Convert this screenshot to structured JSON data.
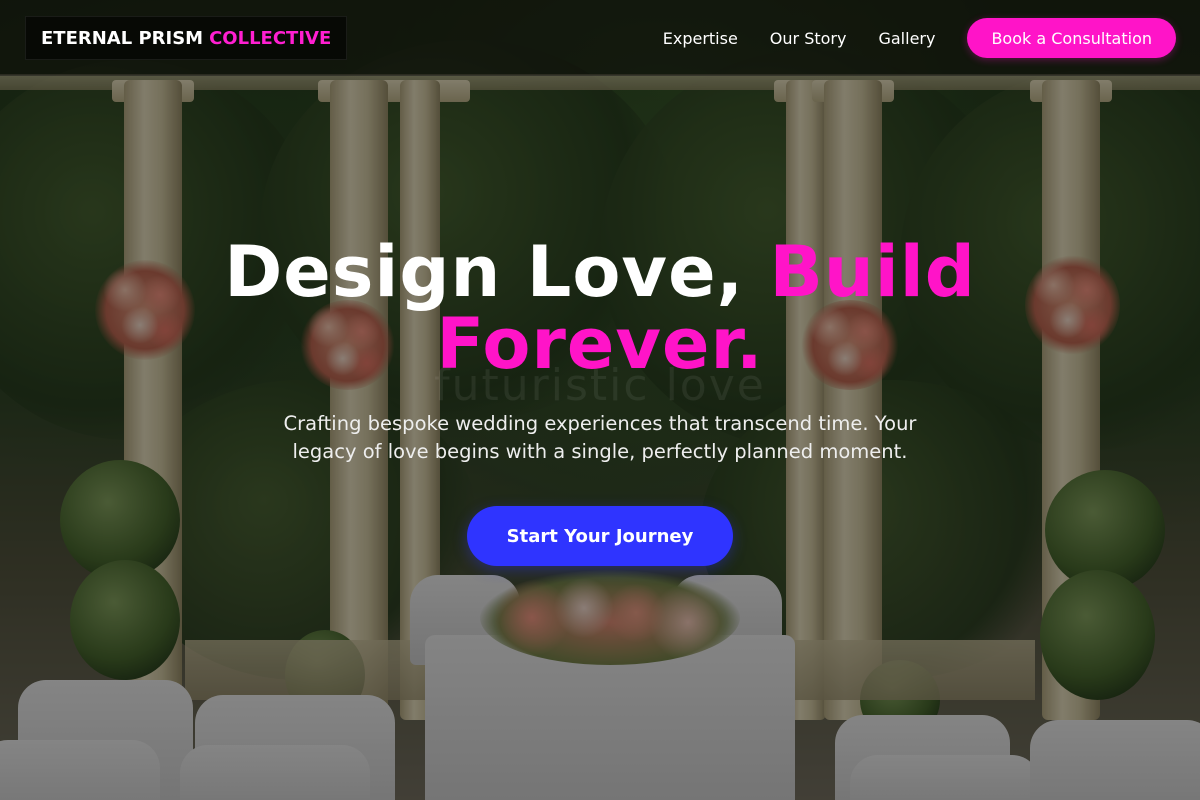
{
  "brand": {
    "name_part1": "ETERNAL PRISM",
    "name_part2": "COLLECTIVE"
  },
  "nav": {
    "links": [
      "Expertise",
      "Our Story",
      "Gallery"
    ],
    "cta_label": "Book a Consultation"
  },
  "hero": {
    "headline_white": "Design Love, ",
    "headline_accent": "Build Forever.",
    "subtitle": "Crafting bespoke wedding experiences that transcend time. Your legacy of love begins with a single, perfectly planned moment.",
    "cta_label": "Start Your Journey",
    "watermark_text": "futuristic love"
  },
  "colors": {
    "accent_pink": "#ff14c8",
    "button_blue": "#2f34ff",
    "text_white": "#ffffff"
  }
}
